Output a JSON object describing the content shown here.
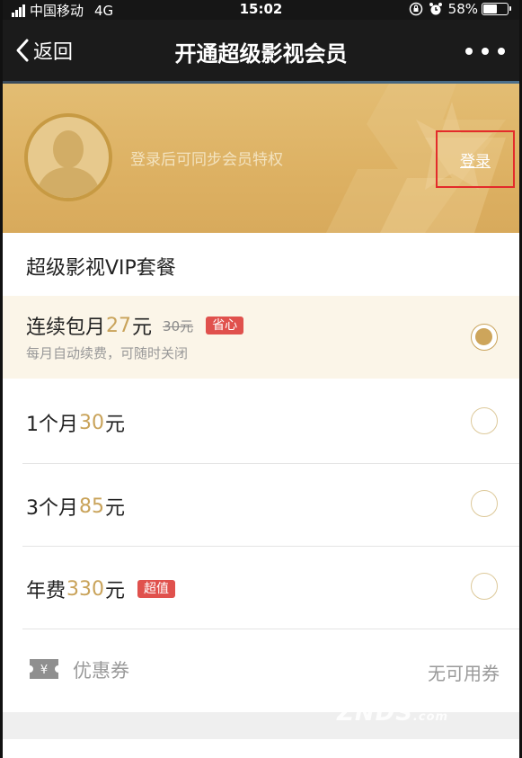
{
  "status_bar": {
    "carrier": "中国移动",
    "network": "4G",
    "time": "15:02",
    "battery": "58%"
  },
  "nav": {
    "back_label": "返回",
    "title": "开通超级影视会员"
  },
  "member": {
    "login_hint": "登录后可同步会员特权",
    "login_label": "登录"
  },
  "packages": {
    "section_title": "超级影视VIP套餐",
    "items": [
      {
        "name": "连续包月",
        "price": "27",
        "unit": "元",
        "old_price": "30元",
        "tag": "省心",
        "subtitle": "每月自动续费，可随时关闭",
        "selected": true
      },
      {
        "name": "1个月",
        "price": "30",
        "unit": "元",
        "selected": false
      },
      {
        "name": "3个月",
        "price": "85",
        "unit": "元",
        "selected": false
      },
      {
        "name": "年费",
        "price": "330",
        "unit": "元",
        "tag": "超值",
        "selected": false
      }
    ]
  },
  "coupon": {
    "label": "优惠券",
    "value": "无可用券"
  },
  "colors": {
    "gold": "#c9a35a",
    "banner": "#ddb163",
    "tag_red": "#e0514d",
    "highlight_box": "#e32b2b"
  },
  "watermark": {
    "text": "ZNDS",
    "suffix": ".com"
  }
}
